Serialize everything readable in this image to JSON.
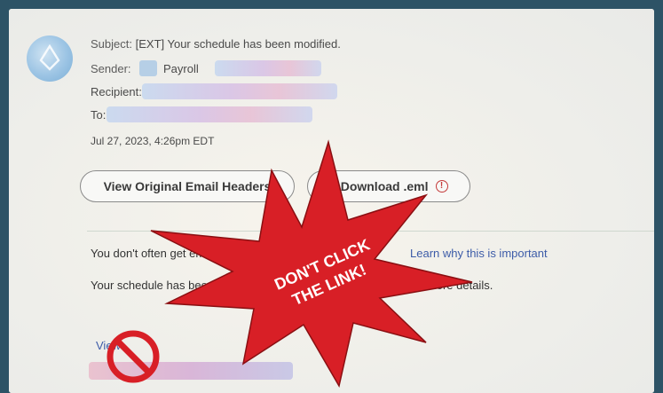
{
  "email": {
    "subject_label": "Subject:",
    "subject_value": "[EXT] Your schedule has been modified.",
    "sender_label": "Sender:",
    "sender_value": "Payroll",
    "recipient_label": "Recipient:",
    "to_label": "To:",
    "timestamp": "Jul 27, 2023, 4:26pm EDT"
  },
  "actions": {
    "view_headers": "View Original Email Headers",
    "download": "Download .eml"
  },
  "body": {
    "notice_text": "You don't often get email from",
    "notice_link": "Learn why this is important",
    "schedule_text": "Your schedule has been modified. Please review the reminder for more details.",
    "view_link": "View"
  },
  "warning": {
    "line1": "DON'T CLICK",
    "line2": "THE LINK!",
    "color": "#d81f26"
  },
  "icons": {
    "download": "download-icon",
    "info": "info-icon",
    "avatar": "avatar-icon",
    "prohibit": "no-sign-icon"
  }
}
